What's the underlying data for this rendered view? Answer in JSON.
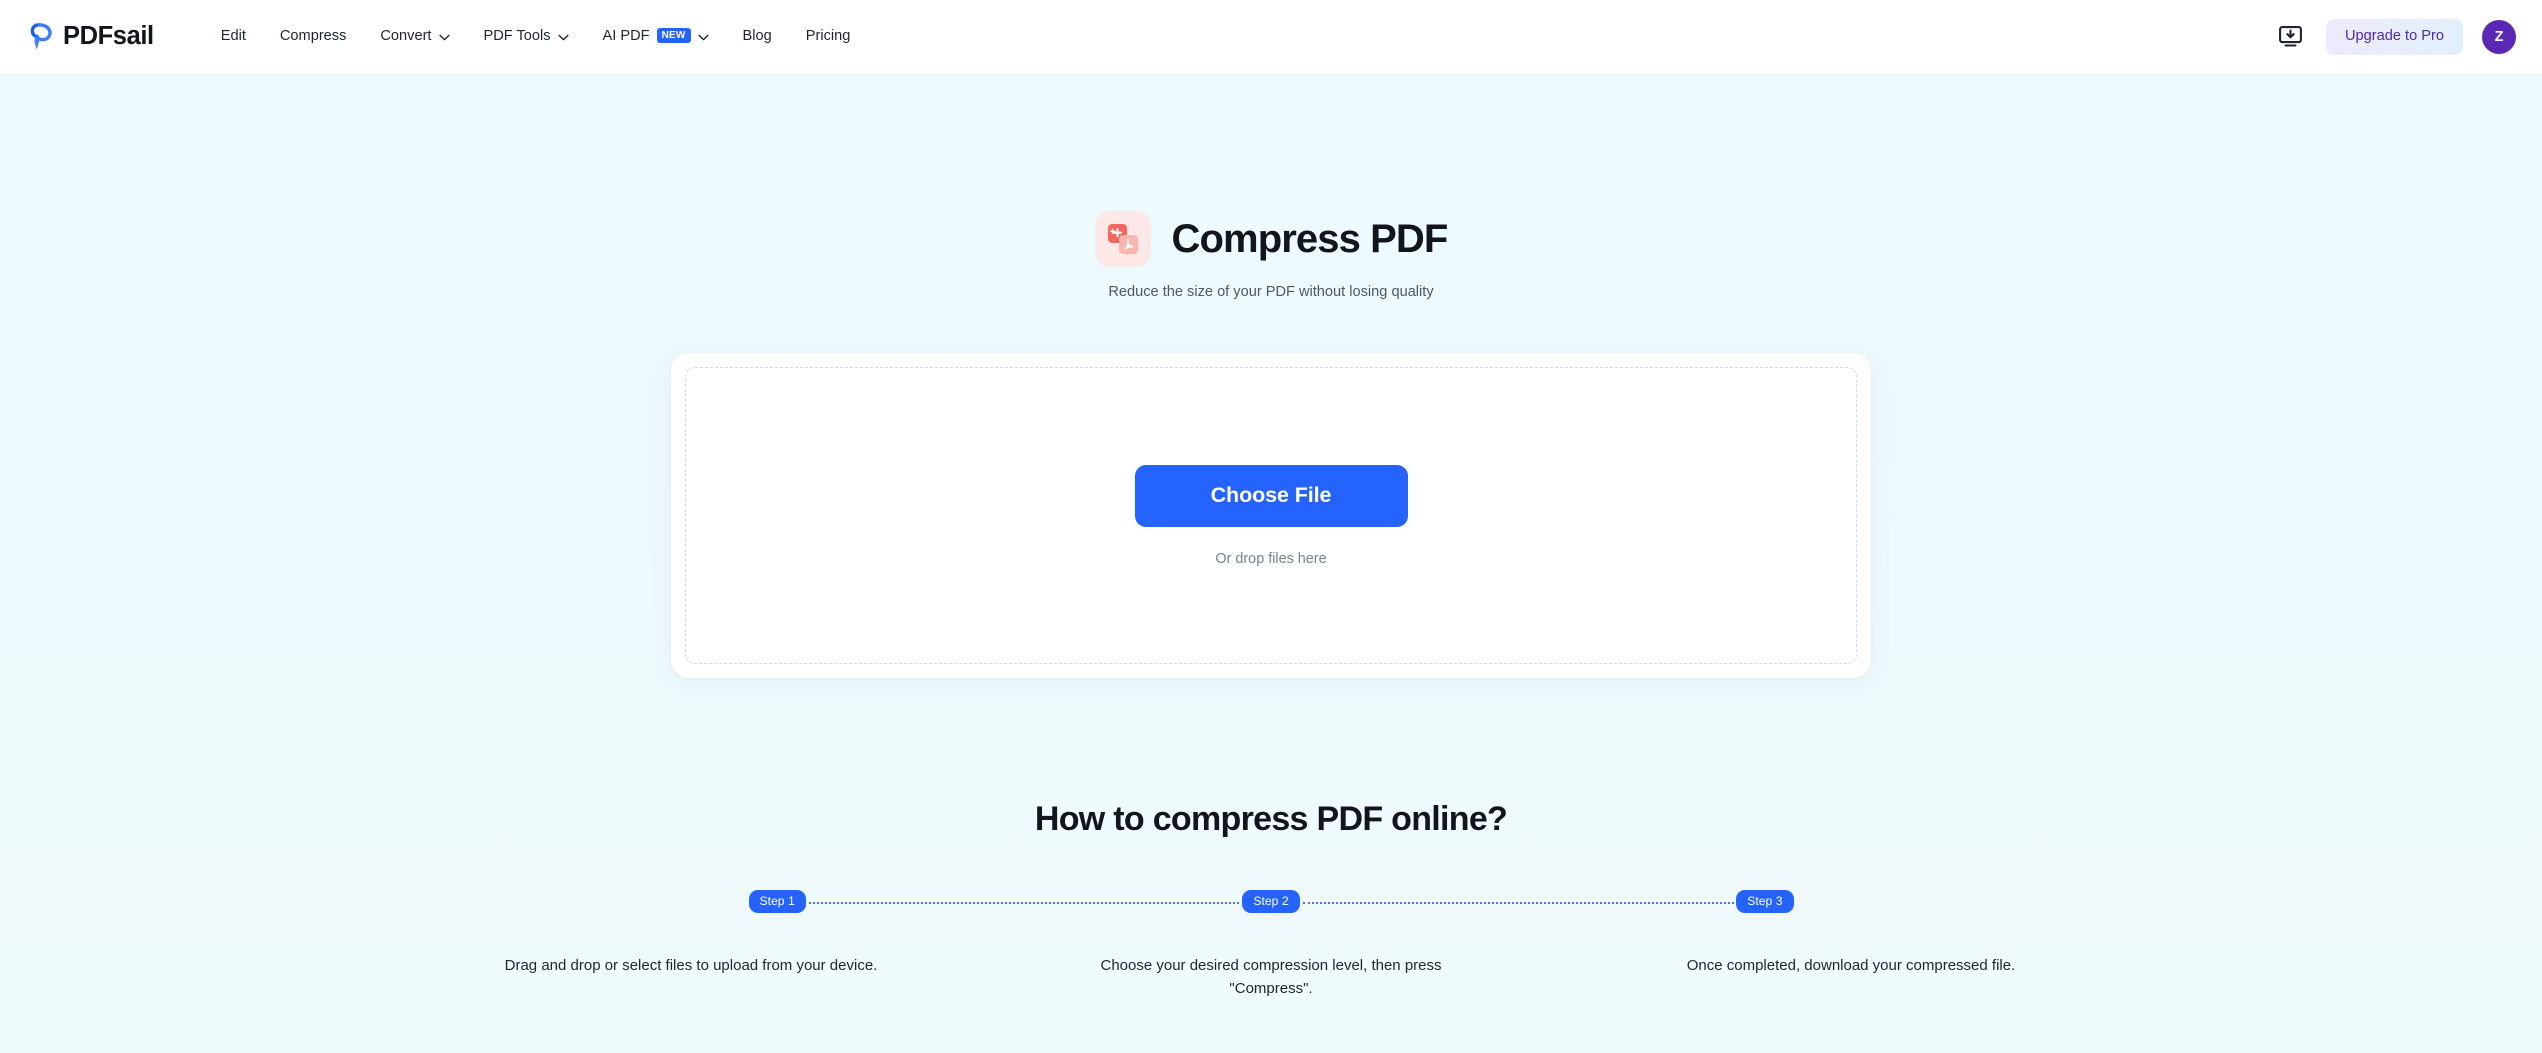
{
  "header": {
    "brand": {
      "name": "PDFsail",
      "logo_icon": "pdfsail-logo-icon",
      "accent": "#3b7dfd"
    },
    "nav": [
      {
        "label": "Edit",
        "icon": null,
        "badge": null
      },
      {
        "label": "Compress",
        "icon": null,
        "badge": null
      },
      {
        "label": "Convert",
        "icon": "chevron-down-icon",
        "badge": null
      },
      {
        "label": "PDF Tools",
        "icon": "chevron-down-icon",
        "badge": null
      },
      {
        "label": "AI PDF",
        "icon": "chevron-down-icon",
        "badge": "NEW"
      },
      {
        "label": "Blog",
        "icon": null,
        "badge": null
      },
      {
        "label": "Pricing",
        "icon": null,
        "badge": null
      }
    ],
    "install_icon": "install-app-icon",
    "upgrade_label": "Upgrade to Pro",
    "avatar_initial": "Z",
    "avatar_color": "#5a28b5"
  },
  "hero": {
    "icon": "compress-pdf-icon",
    "title": "Compress PDF",
    "subtitle": "Reduce the size of your PDF without losing quality"
  },
  "dropzone": {
    "button_label": "Choose File",
    "hint": "Or drop files here",
    "button_color": "#2563ff"
  },
  "howto": {
    "title": "How to compress PDF online?",
    "steps": [
      {
        "badge": "Step 1",
        "text": "Drag and drop or select files to upload from your device."
      },
      {
        "badge": "Step 2",
        "text": "Choose your desired compression level, then press \"Compress\"."
      },
      {
        "badge": "Step 3",
        "text": "Once completed, download your compressed file."
      }
    ]
  }
}
